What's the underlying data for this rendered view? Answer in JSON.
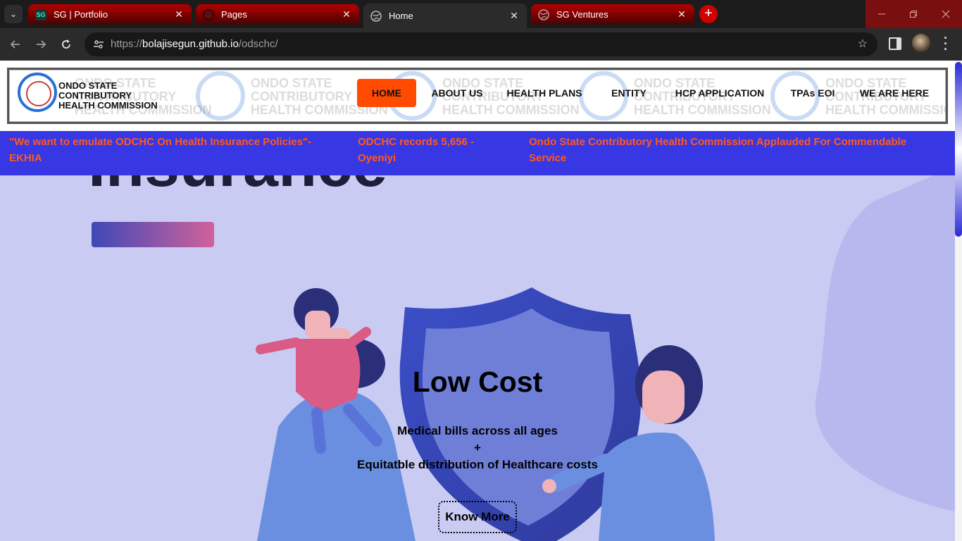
{
  "browser": {
    "tabs": [
      {
        "title": "SG | Portfolio",
        "favicon": "portfolio-favicon",
        "favicon_text": "SG"
      },
      {
        "title": "Pages",
        "favicon": "github-icon"
      },
      {
        "title": "Home",
        "favicon": "globe-icon",
        "active": true
      },
      {
        "title": "SG Ventures",
        "favicon": "globe-icon"
      }
    ],
    "close_glyph": "✕",
    "new_tab_glyph": "+",
    "url_scheme": "https://",
    "url_host": "bolajisegun.github.io",
    "url_path": "/odschc/",
    "colors": {
      "tab_red": "#b50000",
      "tab_active": "#2b2b2b",
      "toolbar": "#2b2b2b",
      "new_tab": "#d10000"
    }
  },
  "site": {
    "brand_lines": "ONDO STATE\nCONTRIBUTORY\nHEALTH COMMISSION",
    "watermark_text": "ONDO STATE\nCONTRIBUTORY\nHEALTH COMMISSION",
    "nav": [
      {
        "label": "HOME",
        "active": true
      },
      {
        "label": "ABOUT US"
      },
      {
        "label": "HEALTH PLANS"
      },
      {
        "label": "ENTITY"
      },
      {
        "label": "HCP APPLICATION"
      },
      {
        "label": "TPAs EOI"
      },
      {
        "label": "WE ARE HERE"
      }
    ],
    "news": [
      "\"We want to emulate ODCHC On Health Insurance Policies\"- EKHIA",
      "ODCHC records 5,656 - Oyeniyi",
      "Ondo State Contributory Health Commission Applauded For Commendable Service"
    ],
    "hero": {
      "title": "Low Cost",
      "line1": "Medical bills across all ages",
      "line2": "+",
      "line3": "Equitatble distribution of Healthcare costs",
      "cta": "Know More",
      "background_word": "Insurance"
    },
    "colors": {
      "nav_active": "#ff4a00",
      "ticker_bg": "#3737e3",
      "ticker_text": "#ff5a1f",
      "hero_bg": "#c9cbf2"
    }
  }
}
